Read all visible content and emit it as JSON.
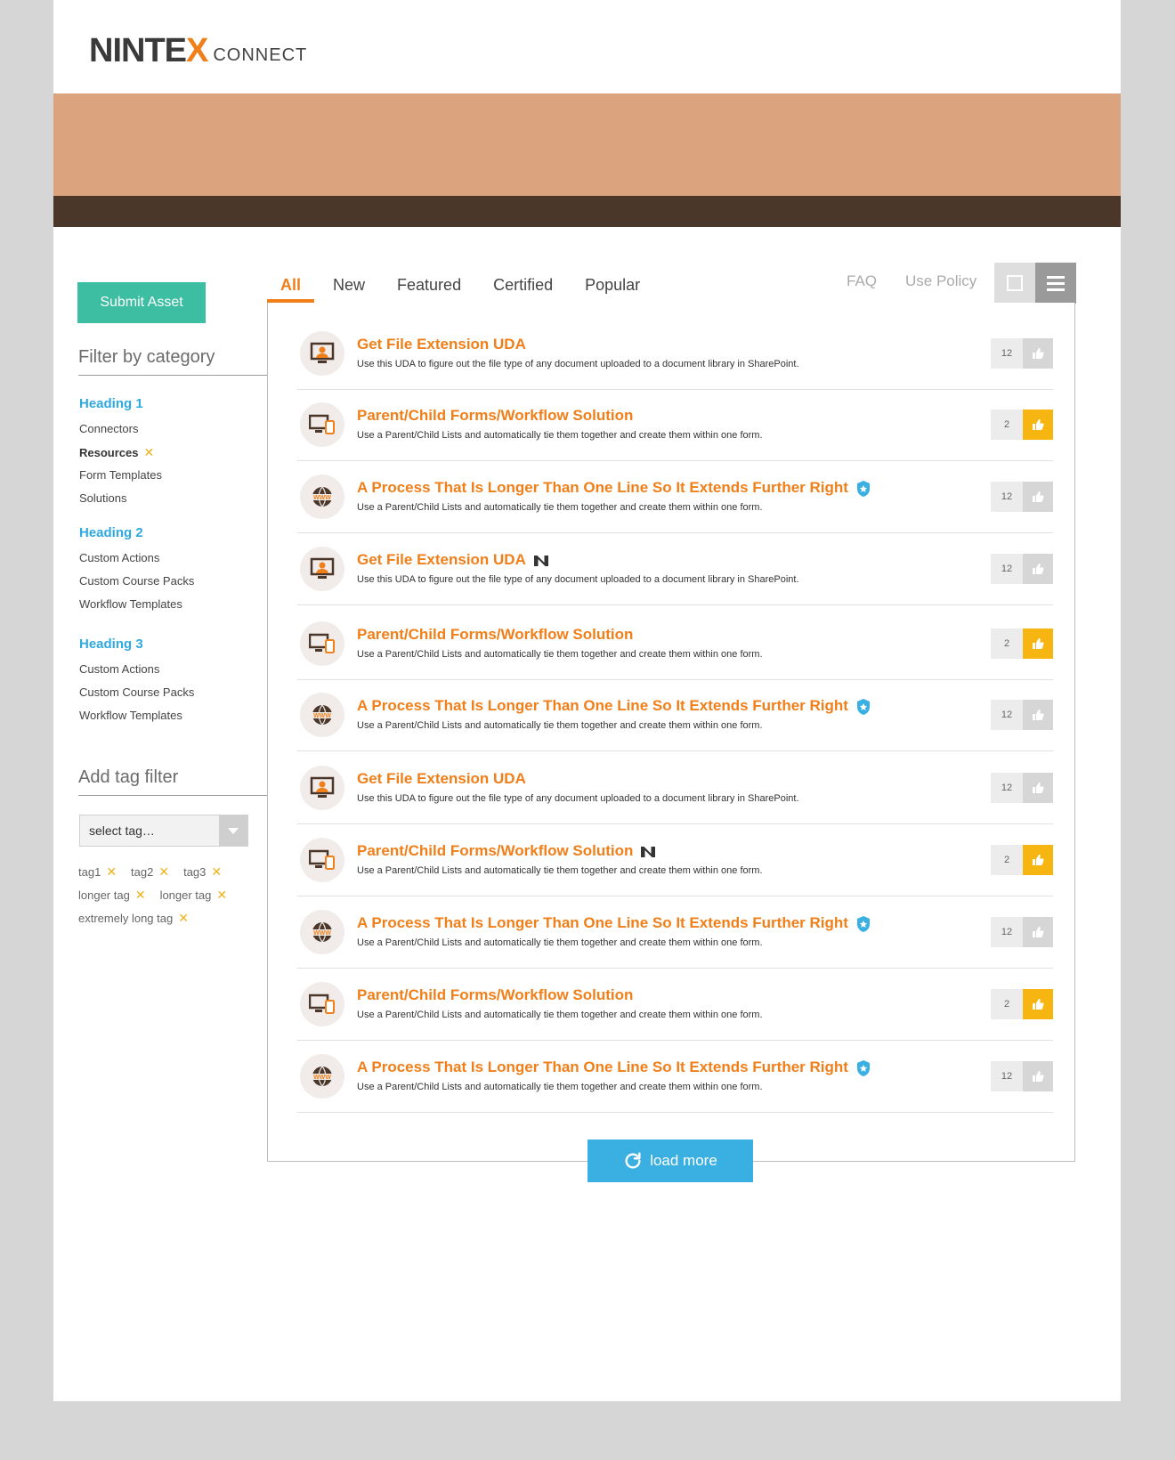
{
  "header": {
    "logo_brand": "NINTE",
    "logo_x": "X",
    "logo_sub": "CONNECT"
  },
  "sidebar": {
    "submit_label": "Submit Asset",
    "filter_title": "Filter by category",
    "groups": [
      {
        "heading": "Heading 1",
        "items": [
          "Connectors",
          "Resources",
          "Form Templates",
          "Solutions"
        ],
        "active_item": "Resources"
      },
      {
        "heading": "Heading 2",
        "items": [
          "Custom Actions",
          "Custom Course Packs",
          "Workflow Templates"
        ]
      },
      {
        "heading": "Heading 3",
        "items": [
          "Custom Actions",
          "Custom Course Packs",
          "Workflow Templates"
        ]
      }
    ],
    "tag_title": "Add tag filter",
    "tag_placeholder": "select tag…",
    "tags": [
      "tag1",
      "tag2",
      "tag3",
      "longer tag",
      "longer tag",
      "extremely long tag"
    ]
  },
  "tabs": [
    "All",
    "New",
    "Featured",
    "Certified",
    "Popular"
  ],
  "active_tab": "All",
  "links": {
    "faq": "FAQ",
    "use_policy": "Use Policy"
  },
  "items": [
    {
      "icon": "monitor-user-icon",
      "title": "Get File Extension UDA",
      "desc": "Use this UDA to figure out the file type of any document uploaded to a document library in SharePoint.",
      "votes": "12",
      "liked": false,
      "badge": ""
    },
    {
      "icon": "devices-icon",
      "title": "Parent/Child Forms/Workflow Solution",
      "desc": "Use a Parent/Child Lists and automatically tie them together and create them within one form.",
      "votes": "2",
      "liked": true,
      "badge": ""
    },
    {
      "icon": "globe-www-icon",
      "title": "A Process That Is Longer Than One Line So It Extends Further Right",
      "desc": "Use a Parent/Child Lists and automatically tie them together and create them within one form.",
      "votes": "12",
      "liked": false,
      "badge": "certified"
    },
    {
      "icon": "monitor-user-icon",
      "title": "Get File Extension UDA",
      "desc": "Use this UDA to figure out the file type of any document uploaded to a document library in SharePoint.",
      "votes": "12",
      "liked": false,
      "badge": "nintex"
    },
    {
      "icon": "devices-icon",
      "title": "Parent/Child Forms/Workflow Solution",
      "desc": "Use a Parent/Child Lists and automatically tie them together and create them within one form.",
      "votes": "2",
      "liked": true,
      "badge": ""
    },
    {
      "icon": "globe-www-icon",
      "title": "A Process That Is Longer Than One Line So It Extends Further Right",
      "desc": "Use a Parent/Child Lists and automatically tie them together and create them within one form.",
      "votes": "12",
      "liked": false,
      "badge": "certified"
    },
    {
      "icon": "monitor-user-icon",
      "title": "Get File Extension UDA",
      "desc": "Use this UDA to figure out the file type of any document uploaded to a document library in SharePoint.",
      "votes": "12",
      "liked": false,
      "badge": ""
    },
    {
      "icon": "devices-icon",
      "title": "Parent/Child Forms/Workflow Solution",
      "desc": "Use a Parent/Child Lists and automatically tie them together and create them within one form.",
      "votes": "2",
      "liked": true,
      "badge": "nintex"
    },
    {
      "icon": "globe-www-icon",
      "title": "A Process That Is Longer Than One Line So It Extends Further Right",
      "desc": "Use a Parent/Child Lists and automatically tie them together and create them within one form.",
      "votes": "12",
      "liked": false,
      "badge": "certified"
    },
    {
      "icon": "devices-icon",
      "title": "Parent/Child Forms/Workflow Solution",
      "desc": "Use a Parent/Child Lists and automatically tie them together and create them within one form.",
      "votes": "2",
      "liked": true,
      "badge": ""
    },
    {
      "icon": "globe-www-icon",
      "title": "A Process That Is Longer Than One Line So It Extends Further Right",
      "desc": "Use a Parent/Child Lists and automatically tie them together and create them within one form.",
      "votes": "12",
      "liked": false,
      "badge": "certified"
    }
  ],
  "load_more_label": "load more",
  "colors": {
    "accent": "#f07f1a",
    "teal": "#3dbda1",
    "blue": "#3aafe2",
    "heading": "#2fa9e0",
    "like": "#f7b512"
  }
}
